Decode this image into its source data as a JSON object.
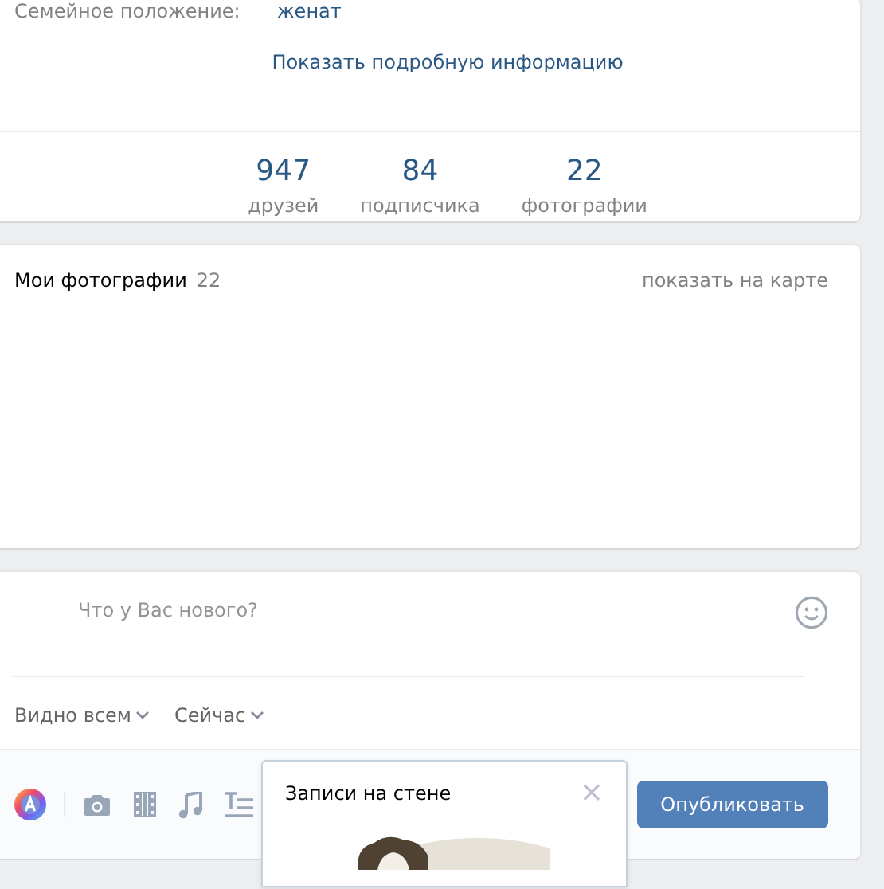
{
  "profile_info": {
    "label": "Семейное положение:",
    "value": "женат",
    "more_link": "Показать подробную информацию"
  },
  "counters": [
    {
      "count": "947",
      "label": "друзей"
    },
    {
      "count": "84",
      "label": "подписчика"
    },
    {
      "count": "22",
      "label": "фотографии"
    }
  ],
  "photos": {
    "title": "Мои фотографии",
    "count": "22",
    "map_link": "показать на карте"
  },
  "composer": {
    "placeholder": "Что у Вас нового?",
    "visibility": "Видно всем",
    "time": "Сейчас",
    "publish_button": "Опубликовать"
  },
  "tooltip": {
    "title": "Записи на стене",
    "close": "×"
  }
}
